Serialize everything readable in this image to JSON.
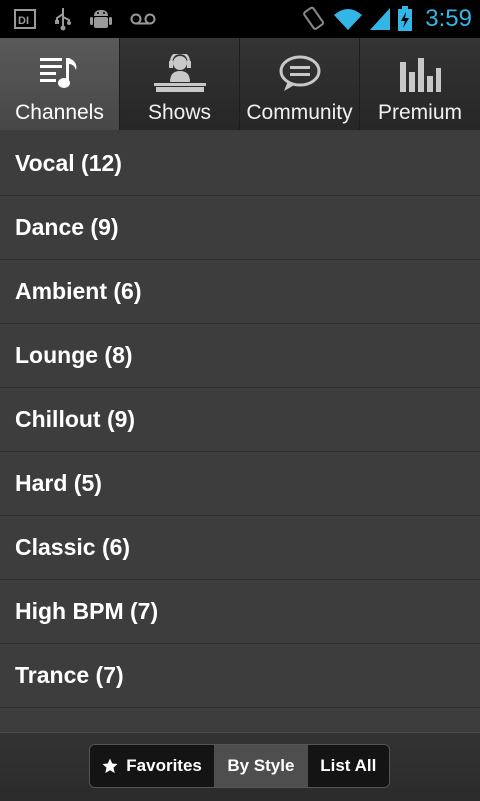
{
  "status_bar": {
    "time": "3:59",
    "left_icons": [
      "di-app-icon",
      "usb-icon",
      "android-debug-icon",
      "voicemail-icon"
    ],
    "right_icons": [
      "rotate-icon",
      "wifi-icon",
      "signal-icon",
      "battery-charging-icon"
    ],
    "time_color": "#33b5e5"
  },
  "tabs": [
    {
      "label": "Channels",
      "icon": "music-list-icon",
      "active": true
    },
    {
      "label": "Shows",
      "icon": "dj-icon",
      "active": false
    },
    {
      "label": "Community",
      "icon": "chat-bubble-icon",
      "active": false
    },
    {
      "label": "Premium",
      "icon": "equalizer-icon",
      "active": false
    }
  ],
  "list_items": [
    "Vocal (12)",
    "Dance (9)",
    "Ambient (6)",
    "Lounge (8)",
    "Chillout (9)",
    "Hard (5)",
    "Classic (6)",
    "High BPM (7)",
    "Trance (7)"
  ],
  "bottom_bar": {
    "favorites_label": "Favorites",
    "by_style_label": "By Style",
    "list_all_label": "List All",
    "selected": "By Style"
  }
}
